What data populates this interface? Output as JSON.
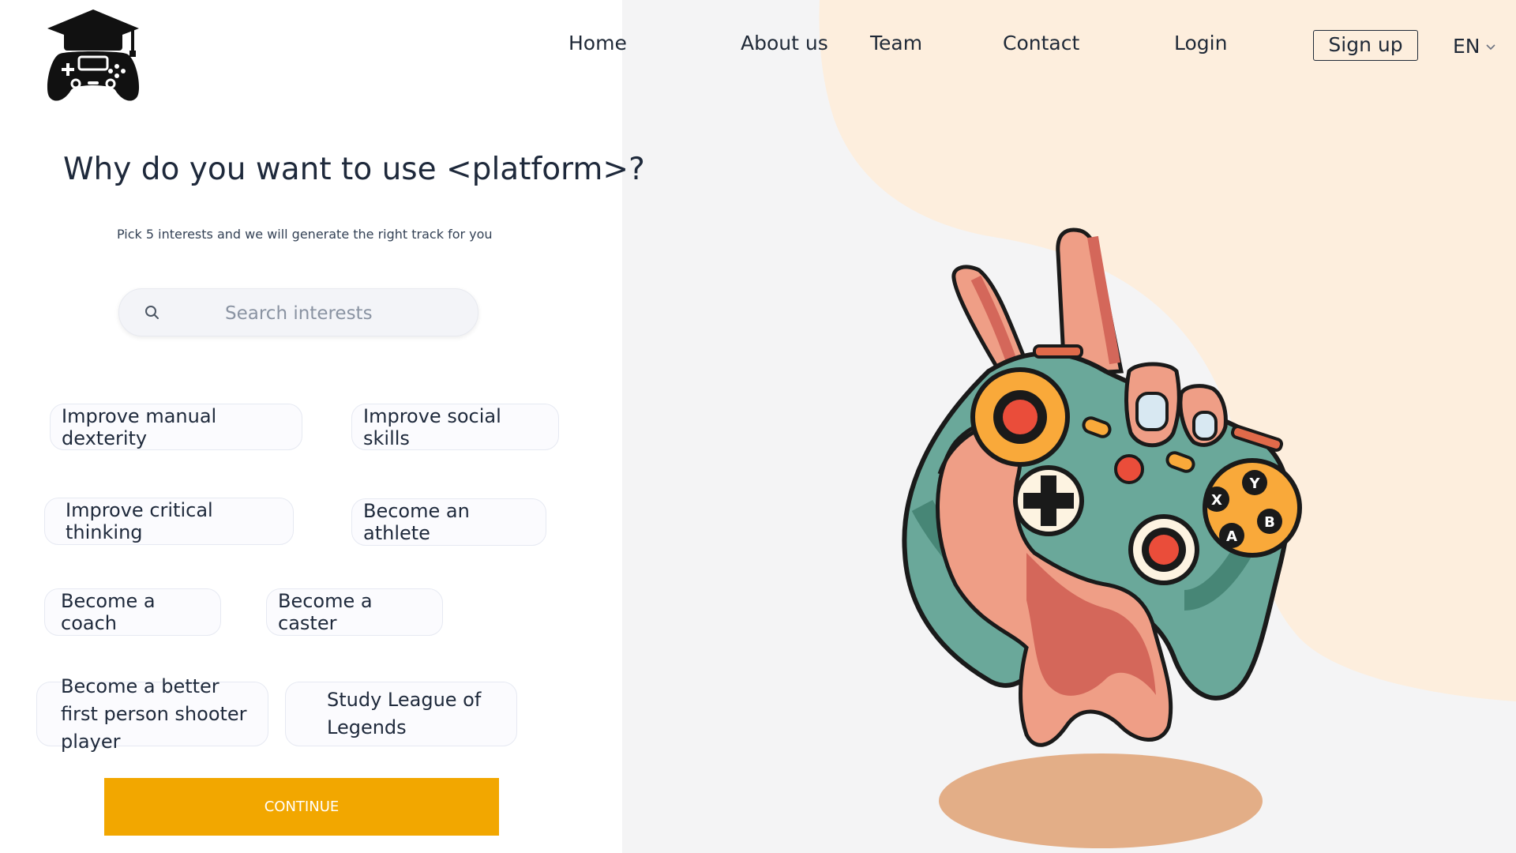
{
  "header": {
    "logo_icon": "graduation-cap-gamepad-icon",
    "nav": [
      "Home",
      "About us",
      "Team",
      "Contact",
      "Login"
    ],
    "signup_label": "Sign up",
    "language": "EN"
  },
  "main": {
    "title": "Why do you want to use <platform>?",
    "subtitle": "Pick 5 interests and we will generate the right track for you",
    "search": {
      "placeholder": "Search interests",
      "value": ""
    },
    "interests": [
      "Improve manual dexterity",
      "Improve social skills",
      "Improve critical thinking",
      "Become an athlete",
      "Become a coach",
      "Become a caster",
      "Become a better first person shooter player",
      "Study League of Legends"
    ],
    "continue_label": "CONTINUE"
  },
  "illustration": {
    "subject": "hand-holding-gamepad-peace-sign-illustration",
    "button_letters": [
      "Y",
      "X",
      "B",
      "A"
    ]
  },
  "colors": {
    "accent": "#f2a700",
    "right_panel_bg": "#f4f4f5",
    "blob": "#fdeedd",
    "gamepad": "#6aa89a",
    "skin": "#ef9e86",
    "shadow": "#e3ae87"
  }
}
